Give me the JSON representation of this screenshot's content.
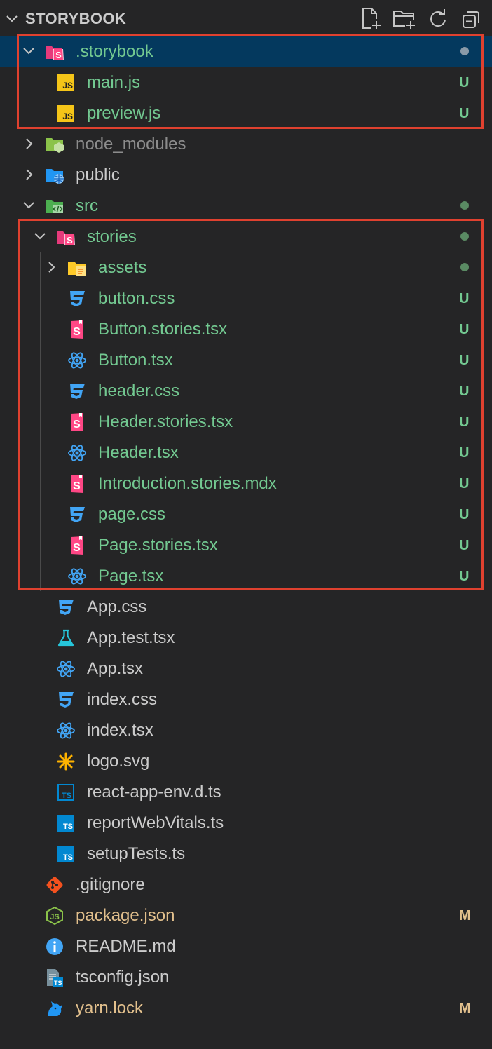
{
  "explorer": {
    "title": "STORYBOOK",
    "actions": [
      {
        "name": "new-file-icon"
      },
      {
        "name": "new-folder-icon"
      },
      {
        "name": "refresh-icon"
      },
      {
        "name": "collapse-all-icon"
      }
    ]
  },
  "colors": {
    "background": "#252526",
    "selected": "#04395e",
    "untracked": "#73c991",
    "modified": "#e2c08d",
    "ignored": "#8c8c8c",
    "default_text": "#cccccc",
    "highlight_box": "#e0412f",
    "dot_color": "#5a8a63"
  },
  "tree": [
    {
      "label": ".storybook",
      "depth": 0,
      "type": "folder",
      "expanded": true,
      "icon": "storybook-folder-icon",
      "status": "untracked",
      "dot": true,
      "selected": true
    },
    {
      "label": "main.js",
      "depth": 1,
      "type": "file",
      "icon": "javascript-file-icon",
      "status": "untracked",
      "badge": "U"
    },
    {
      "label": "preview.js",
      "depth": 1,
      "type": "file",
      "icon": "javascript-file-icon",
      "status": "untracked",
      "badge": "U"
    },
    {
      "label": "node_modules",
      "depth": 0,
      "type": "folder",
      "expanded": false,
      "icon": "node-folder-icon",
      "status": "ignored"
    },
    {
      "label": "public",
      "depth": 0,
      "type": "folder",
      "expanded": false,
      "icon": "public-folder-icon",
      "status": "normal"
    },
    {
      "label": "src",
      "depth": 0,
      "type": "folder",
      "expanded": true,
      "icon": "src-folder-icon",
      "status": "untracked",
      "dot": true
    },
    {
      "label": "stories",
      "depth": 1,
      "type": "folder",
      "expanded": true,
      "icon": "storybook-folder-icon",
      "status": "untracked",
      "dot": true
    },
    {
      "label": "assets",
      "depth": 2,
      "type": "folder",
      "expanded": false,
      "icon": "assets-folder-icon",
      "status": "untracked",
      "dot": true
    },
    {
      "label": "button.css",
      "depth": 2,
      "type": "file",
      "icon": "css-file-icon",
      "status": "untracked",
      "badge": "U"
    },
    {
      "label": "Button.stories.tsx",
      "depth": 2,
      "type": "file",
      "icon": "storybook-file-icon",
      "status": "untracked",
      "badge": "U"
    },
    {
      "label": "Button.tsx",
      "depth": 2,
      "type": "file",
      "icon": "react-file-icon",
      "status": "untracked",
      "badge": "U"
    },
    {
      "label": "header.css",
      "depth": 2,
      "type": "file",
      "icon": "css-file-icon",
      "status": "untracked",
      "badge": "U"
    },
    {
      "label": "Header.stories.tsx",
      "depth": 2,
      "type": "file",
      "icon": "storybook-file-icon",
      "status": "untracked",
      "badge": "U"
    },
    {
      "label": "Header.tsx",
      "depth": 2,
      "type": "file",
      "icon": "react-file-icon",
      "status": "untracked",
      "badge": "U"
    },
    {
      "label": "Introduction.stories.mdx",
      "depth": 2,
      "type": "file",
      "icon": "storybook-file-icon",
      "status": "untracked",
      "badge": "U"
    },
    {
      "label": "page.css",
      "depth": 2,
      "type": "file",
      "icon": "css-file-icon",
      "status": "untracked",
      "badge": "U"
    },
    {
      "label": "Page.stories.tsx",
      "depth": 2,
      "type": "file",
      "icon": "storybook-file-icon",
      "status": "untracked",
      "badge": "U"
    },
    {
      "label": "Page.tsx",
      "depth": 2,
      "type": "file",
      "icon": "react-file-icon",
      "status": "untracked",
      "badge": "U"
    },
    {
      "label": "App.css",
      "depth": 1,
      "type": "file",
      "icon": "css-file-icon",
      "status": "normal"
    },
    {
      "label": "App.test.tsx",
      "depth": 1,
      "type": "file",
      "icon": "test-flask-icon",
      "status": "normal"
    },
    {
      "label": "App.tsx",
      "depth": 1,
      "type": "file",
      "icon": "react-file-icon",
      "status": "normal"
    },
    {
      "label": "index.css",
      "depth": 1,
      "type": "file",
      "icon": "css-file-icon",
      "status": "normal"
    },
    {
      "label": "index.tsx",
      "depth": 1,
      "type": "file",
      "icon": "react-file-icon",
      "status": "normal"
    },
    {
      "label": "logo.svg",
      "depth": 1,
      "type": "file",
      "icon": "svg-asterisk-icon",
      "status": "normal"
    },
    {
      "label": "react-app-env.d.ts",
      "depth": 1,
      "type": "file",
      "icon": "typescript-def-icon",
      "status": "normal"
    },
    {
      "label": "reportWebVitals.ts",
      "depth": 1,
      "type": "file",
      "icon": "typescript-file-icon",
      "status": "normal"
    },
    {
      "label": "setupTests.ts",
      "depth": 1,
      "type": "file",
      "icon": "typescript-file-icon",
      "status": "normal"
    },
    {
      "label": ".gitignore",
      "depth": 0,
      "type": "file",
      "icon": "git-icon",
      "status": "normal"
    },
    {
      "label": "package.json",
      "depth": 0,
      "type": "file",
      "icon": "nodejs-file-icon",
      "status": "modified",
      "badge": "M"
    },
    {
      "label": "README.md",
      "depth": 0,
      "type": "file",
      "icon": "info-icon",
      "status": "normal"
    },
    {
      "label": "tsconfig.json",
      "depth": 0,
      "type": "file",
      "icon": "tsconfig-file-icon",
      "status": "normal"
    },
    {
      "label": "yarn.lock",
      "depth": 0,
      "type": "file",
      "icon": "yarn-cat-icon",
      "status": "modified",
      "badge": "M"
    }
  ]
}
